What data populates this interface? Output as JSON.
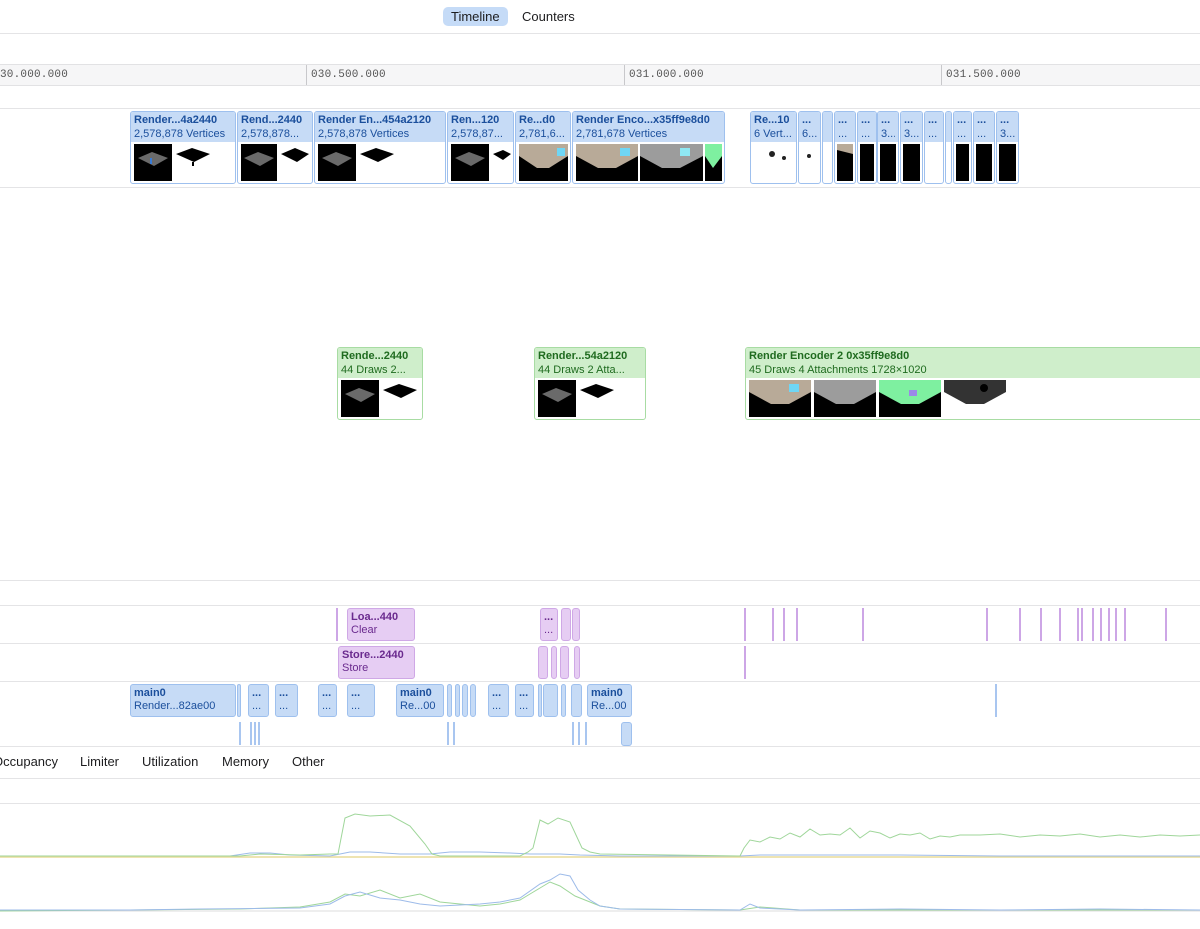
{
  "toolbar": {
    "timeline_label": "Timeline",
    "counters_label": "Counters"
  },
  "ruler": {
    "ticks": [
      "30.000.000",
      "030.500.000",
      "031.000.000",
      "031.500.000"
    ]
  },
  "vertex_row": {
    "cards": [
      {
        "title": "Render...4a2440",
        "subtitle": "2,578,878 Vertices"
      },
      {
        "title": "Rend...2440",
        "subtitle": "2,578,878..."
      },
      {
        "title": "Render En...454a2120",
        "subtitle": "2,578,878 Vertices"
      },
      {
        "title": "Ren...120",
        "subtitle": "2,578,87..."
      },
      {
        "title": "Re...d0",
        "subtitle": "2,781,6..."
      },
      {
        "title": "Render Enco...x35ff9e8d0",
        "subtitle": "2,781,678 Vertices"
      },
      {
        "title": "Re...10",
        "subtitle": "6 Vert..."
      },
      {
        "title": "...",
        "subtitle": "6..."
      },
      {
        "title": "...",
        "subtitle": "..."
      },
      {
        "title": "...",
        "subtitle": "..."
      },
      {
        "title": "...",
        "subtitle": "3..."
      },
      {
        "title": "...",
        "subtitle": "3..."
      },
      {
        "title": "...",
        "subtitle": "..."
      },
      {
        "title": "...",
        "subtitle": "..."
      },
      {
        "title": "...",
        "subtitle": "..."
      },
      {
        "title": "...",
        "subtitle": "3..."
      }
    ]
  },
  "fragment_row": {
    "cards": [
      {
        "title": "Rende...2440",
        "subtitle": "44 Draws     2..."
      },
      {
        "title": "Render...54a2120",
        "subtitle": "44 Draws     2 Atta..."
      },
      {
        "title": "Render Encoder 2 0x35ff9e8d0",
        "subtitle": "45 Draws     4 Attachments     1728×1020"
      }
    ]
  },
  "load_row": {
    "items": [
      {
        "title": "Loa...440",
        "subtitle": "Clear"
      },
      {
        "title": "...",
        "subtitle": "..."
      }
    ]
  },
  "store_row": {
    "items": [
      {
        "title": "Store...2440",
        "subtitle": "Store"
      }
    ]
  },
  "command_row": {
    "items": [
      {
        "title": "main0",
        "subtitle": "Render...82ae00"
      },
      {
        "title": "...",
        "subtitle": "..."
      },
      {
        "title": "...",
        "subtitle": "..."
      },
      {
        "title": "...",
        "subtitle": "..."
      },
      {
        "title": "...",
        "subtitle": "..."
      },
      {
        "title": "main0",
        "subtitle": "Re...00"
      },
      {
        "title": "...",
        "subtitle": "..."
      },
      {
        "title": "...",
        "subtitle": "..."
      },
      {
        "title": "main0",
        "subtitle": "Re...00"
      }
    ]
  },
  "bottom_tabs": [
    "Occupancy",
    "Limiter",
    "Utilization",
    "Memory",
    "Other"
  ],
  "colors": {
    "vertex": "#c6dbf6",
    "fragment": "#cfeecb",
    "attachment": "#e6cdf3",
    "line_green": "#9fd69a",
    "line_blue": "#9dbbe9",
    "line_yellow": "#e8dc98"
  }
}
